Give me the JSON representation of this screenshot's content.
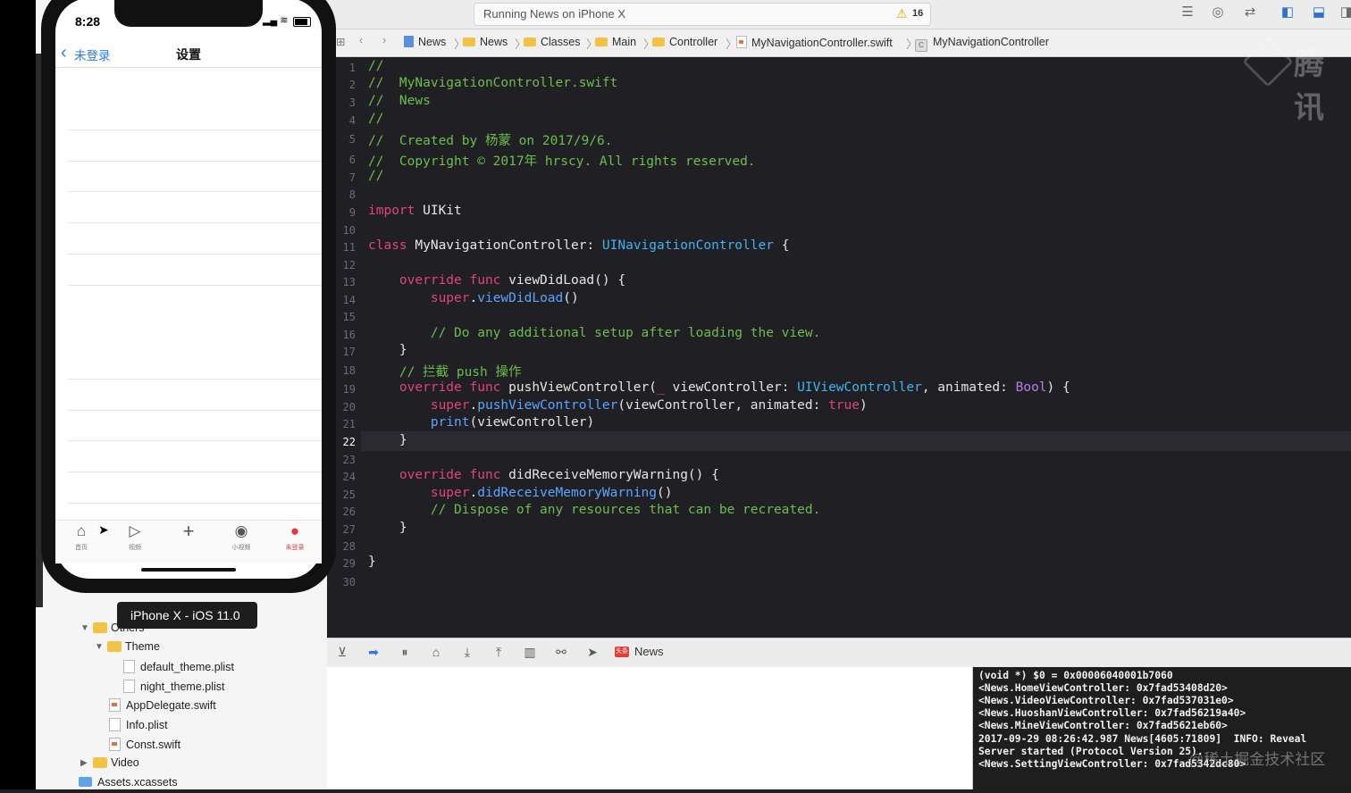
{
  "toolbar": {
    "activity": "Running News on iPhone X",
    "warnings": "16"
  },
  "jumpbar": {
    "items": [
      "News",
      "News",
      "Classes",
      "Main",
      "Controller",
      "MyNavigationController.swift",
      "MyNavigationController"
    ]
  },
  "watermark": "腾讯",
  "editor": {
    "line_numbers": [
      "1",
      "2",
      "3",
      "4",
      "5",
      "6",
      "7",
      "8",
      "9",
      "10",
      "11",
      "12",
      "13",
      "14",
      "15",
      "16",
      "17",
      "18",
      "19",
      "20",
      "21",
      "22",
      "23",
      "24",
      "25",
      "26",
      "27",
      "28",
      "29",
      "30"
    ],
    "current_line": "22",
    "lines": {
      "l1": "//",
      "l2": "//  MyNavigationController.swift",
      "l3": "//  News",
      "l4": "//",
      "l5": "//  Created by 杨蒙 on 2017/9/6.",
      "l6": "//  Copyright © 2017年 hrscy. All rights reserved.",
      "l7": "//",
      "l9_kw": "import",
      "l9_rest": " UIKit",
      "l11_kw": "class",
      "l11_name": " MyNavigationController: ",
      "l11_type": "UINavigationController",
      "l11_end": " {",
      "l13_kw": "    override func",
      "l13_rest": " viewDidLoad() {",
      "l14_super": "        super",
      "l14_dot": ".",
      "l14_fn": "viewDidLoad",
      "l14_end": "()",
      "l16": "        // Do any additional setup after loading the view.",
      "l17": "    }",
      "l18": "    // 拦截 push 操作",
      "l19_kw": "    override func",
      "l19_a": " pushViewController(",
      "l19_us": "_",
      "l19_b": " viewController: ",
      "l19_type": "UIViewController",
      "l19_c": ", animated: ",
      "l19_bool": "Bool",
      "l19_end": ") {",
      "l20_super": "        super",
      "l20_dot": ".",
      "l20_fn": "pushViewController",
      "l20_mid": "(viewController, animated: ",
      "l20_true": "true",
      "l20_end": ")",
      "l21_fn": "        print",
      "l21_end": "(viewController)",
      "l22": "    }",
      "l24_kw": "    override func",
      "l24_rest": " didReceiveMemoryWarning() {",
      "l25_super": "        super",
      "l25_dot": ".",
      "l25_fn": "didReceiveMemoryWarning",
      "l25_end": "()",
      "l26": "        // Dispose of any resources that can be recreated.",
      "l27": "    }",
      "l29": "}"
    }
  },
  "debug": {
    "app_badge": "头条",
    "app_name": "News"
  },
  "console": {
    "lines": [
      "(void *) $0 = 0x00006040001b7060",
      "<News.HomeViewController: 0x7fad53408d20>",
      "<News.VideoViewController: 0x7fad537031e0>",
      "<News.HuoshanViewController: 0x7fad56219a40>",
      "<News.MineViewController: 0x7fad5621eb60>",
      "2017-09-29 08:26:42.987 News[4605:71809]  INFO: Reveal",
      "Server started (Protocol Version 25).",
      "<News.SettingViewController: 0x7fad5342dc80>"
    ],
    "watermark": "@稀土掘金技术社区"
  },
  "device_tooltip": "iPhone X - iOS 11.0",
  "file_tree": {
    "others": "Others",
    "theme": "Theme",
    "default_theme": "default_theme.plist",
    "night_theme": "night_theme.plist",
    "app_delegate": "AppDelegate.swift",
    "info_plist": "Info.plist",
    "const": "Const.swift",
    "video": "Video",
    "assets": "Assets.xcassets"
  },
  "phone": {
    "time": "8:28",
    "back_label": "未登录",
    "title": "设置",
    "tabs": [
      {
        "label": "首页",
        "icon": "house-icon"
      },
      {
        "label": "视频",
        "icon": "play-icon"
      },
      {
        "label": "",
        "icon": "plus-icon"
      },
      {
        "label": "小视频",
        "icon": "small-video-icon"
      },
      {
        "label": "未登录",
        "icon": "person-icon"
      }
    ]
  },
  "colors": {
    "accent_blue": "#2a7cf5",
    "tab_active": "#e4393c",
    "comment": "#6bbf4b",
    "keyword": "#e0457b",
    "type": "#3fb4f0"
  }
}
